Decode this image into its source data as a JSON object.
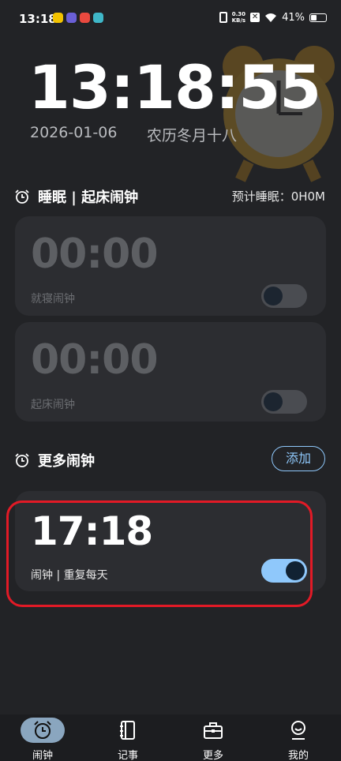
{
  "status_bar": {
    "time": "13:18",
    "net_speed_value": "0.30",
    "net_speed_unit": "KB/s",
    "battery_percent": "41%",
    "battery_level": 0.41,
    "app_icon_colors": [
      "#f2c200",
      "#6a5fd6",
      "#e9493f",
      "#3fb7c8"
    ]
  },
  "header": {
    "time": "13:18:55",
    "date": "2026-01-06",
    "lunar": "农历冬月十八"
  },
  "sleep_section": {
    "title": "睡眠 | 起床闹钟",
    "estimate": "预计睡眠：0H0M",
    "bedtime": {
      "time": "00:00",
      "label": "就寝闹钟",
      "enabled": false
    },
    "wakeup": {
      "time": "00:00",
      "label": "起床闹钟",
      "enabled": false
    }
  },
  "more_section": {
    "title": "更多闹钟",
    "add_label": "添加",
    "alarms": [
      {
        "time": "17:18",
        "label": "闹钟 | 重复每天",
        "enabled": true
      }
    ]
  },
  "bottom_nav": {
    "items": [
      {
        "label": "闹钟",
        "icon": "alarm-clock-icon",
        "active": true
      },
      {
        "label": "记事",
        "icon": "notebook-icon",
        "active": false
      },
      {
        "label": "更多",
        "icon": "toolbox-icon",
        "active": false
      },
      {
        "label": "我的",
        "icon": "profile-icon",
        "active": false
      }
    ]
  },
  "colors": {
    "background": "#222326",
    "card": "#2c2d31",
    "accent": "#8fc8fb",
    "highlight": "#e21a26"
  }
}
